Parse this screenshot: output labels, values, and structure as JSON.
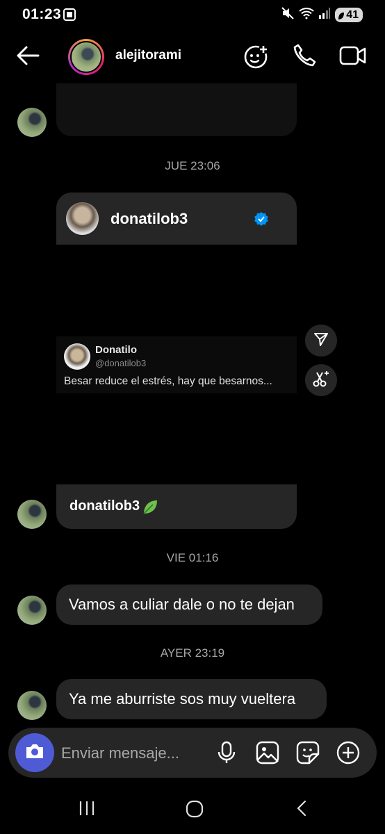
{
  "status_bar": {
    "time": "01:23",
    "battery": "41"
  },
  "header": {
    "username": "alejitorami"
  },
  "messages": {
    "stamp_thu": "JUE 23:06",
    "shared_profile": "donatilob3",
    "tweet": {
      "name": "Donatilo",
      "handle": "@donatilob3",
      "text": "Besar reduce el estrés, hay que besarnos..."
    },
    "caption": "donatilob3",
    "stamp_fri": "VIE 01:16",
    "msg1": "Vamos a culiar dale o no te dejan",
    "stamp_yesterday": "AYER 23:19",
    "msg2": "Ya me aburriste sos muy vueltera"
  },
  "composer": {
    "placeholder": "Enviar mensaje..."
  },
  "colors": {
    "camera_button": "#4f5bd5",
    "verified": "#0095f6",
    "bubble": "#262626"
  }
}
